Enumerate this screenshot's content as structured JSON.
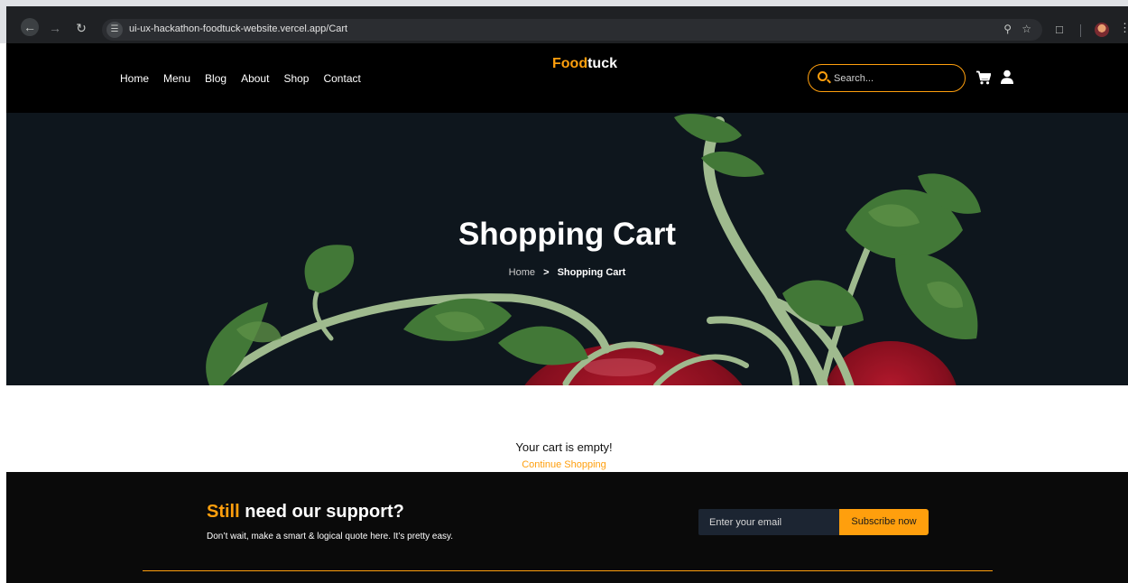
{
  "browser": {
    "url": "ui-ux-hackathon-foodtuck-website.vercel.app/Cart",
    "icons": [
      "back-arrow-icon",
      "forward-arrow-icon",
      "reload-icon",
      "site-info-icon",
      "zoom-icon",
      "star-icon",
      "extensions-icon",
      "profile-avatar",
      "kebab-menu-icon"
    ]
  },
  "header": {
    "nav": [
      "Home",
      "Menu",
      "Blog",
      "About",
      "Shop",
      "Contact"
    ],
    "logo_accent": "Food",
    "logo_rest": "tuck",
    "search_placeholder": "Search...",
    "icons": [
      "search-icon",
      "cart-icon",
      "user-icon"
    ]
  },
  "hero": {
    "title": "Shopping Cart",
    "breadcrumb": {
      "home": "Home",
      "separator": ">",
      "current": "Shopping Cart"
    }
  },
  "cart": {
    "empty_message": "Your cart is empty!",
    "continue_link": "Continue Shopping"
  },
  "footer": {
    "title_accent": "Still",
    "title_rest": " need our support?",
    "subtitle": "Don’t wait, make a smart & logical quote here. It’s pretty easy.",
    "email_placeholder": "Enter your email",
    "subscribe_label": "Subscribe now"
  },
  "colors": {
    "accent": "#FF9F0D",
    "header_bg": "#000000",
    "hero_bg": "#0F171E",
    "footer_bg": "#0A0A0A"
  }
}
